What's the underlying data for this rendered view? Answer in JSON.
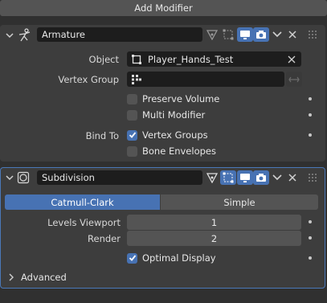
{
  "add_modifier": {
    "label": "Add Modifier"
  },
  "armature": {
    "name": "Armature",
    "object_label": "Object",
    "object_value": "Player_Hands_Test",
    "vertex_group_label": "Vertex Group",
    "vertex_group_value": "",
    "preserve_volume": {
      "label": "Preserve Volume",
      "checked": false
    },
    "multi_modifier": {
      "label": "Multi Modifier",
      "checked": false
    },
    "bind_to_label": "Bind To",
    "vertex_groups": {
      "label": "Vertex Groups",
      "checked": true
    },
    "bone_envelopes": {
      "label": "Bone Envelopes",
      "checked": false
    }
  },
  "subdivision": {
    "name": "Subdivision",
    "tabs": [
      "Catmull-Clark",
      "Simple"
    ],
    "active_tab": "Catmull-Clark",
    "levels_viewport_label": "Levels Viewport",
    "levels_viewport_value": "1",
    "render_label": "Render",
    "render_value": "2",
    "optimal_display": {
      "label": "Optimal Display",
      "checked": true
    },
    "advanced_label": "Advanced"
  },
  "colors": {
    "accent": "#4772b3",
    "panel": "#3d3d3d",
    "background": "#303030",
    "field": "#1d1d1d"
  }
}
